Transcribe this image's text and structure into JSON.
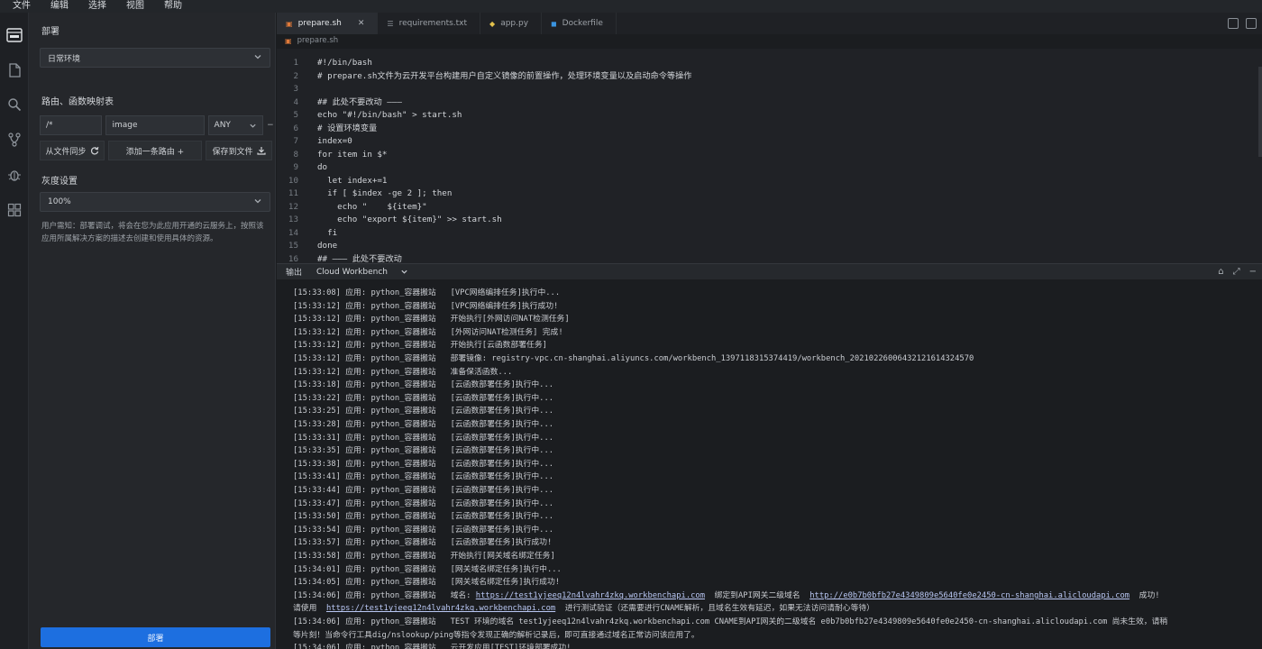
{
  "menu": [
    "文件",
    "编辑",
    "选择",
    "视图",
    "帮助"
  ],
  "sidebar": {
    "title": "部署",
    "env_select": "日常环境",
    "route_title": "路由、函数映射表",
    "route": {
      "path": "/*",
      "target": "image",
      "method": "ANY"
    },
    "sync_button": "从文件同步",
    "add_route_button": "添加一条路由 +",
    "save_file_button": "保存到文件",
    "gray_title": "灰度设置",
    "gray_value": "100%",
    "note": "用户需知：部署调试，将会在您为此应用开通的云服务上，按照该应用所属解决方案的描述去创建和使用具体的资源。",
    "deploy_button": "部署"
  },
  "tabs": [
    {
      "label": "prepare.sh",
      "active": true
    },
    {
      "label": "requirements.txt",
      "active": false
    },
    {
      "label": "app.py",
      "active": false
    },
    {
      "label": "Dockerfile",
      "active": false
    }
  ],
  "breadcrumb": "prepare.sh",
  "code": [
    {
      "n": "1",
      "t": "#!/bin/bash"
    },
    {
      "n": "2",
      "t": "# prepare.sh文件为云开发平台构建用户自定义镜像的前置操作，处理环境变量以及启动命令等操作"
    },
    {
      "n": "3",
      "t": ""
    },
    {
      "n": "4",
      "t": "## 此处不要改动 ———"
    },
    {
      "n": "5",
      "t": "echo \"#!/bin/bash\" > start.sh"
    },
    {
      "n": "6",
      "t": "# 设置环境变量"
    },
    {
      "n": "7",
      "t": "index=0"
    },
    {
      "n": "8",
      "t": "for item in $*"
    },
    {
      "n": "9",
      "t": "do"
    },
    {
      "n": "10",
      "t": "  let index+=1"
    },
    {
      "n": "11",
      "t": "  if [ $index -ge 2 ]; then"
    },
    {
      "n": "12",
      "t": "    echo \"    ${item}\""
    },
    {
      "n": "13",
      "t": "    echo \"export ${item}\" >> start.sh"
    },
    {
      "n": "14",
      "t": "  fi"
    },
    {
      "n": "15",
      "t": "done"
    },
    {
      "n": "16",
      "t": "## ——— 此处不要改动"
    }
  ],
  "panel": {
    "label": "输出",
    "channel": "Cloud Workbench"
  },
  "logs": [
    "[15:33:08] 应用: python_容器搬站   [VPC网络编排任务]执行中...",
    "[15:33:12] 应用: python_容器搬站   [VPC网络编排任务]执行成功!",
    "[15:33:12] 应用: python_容器搬站   开始执行[外网访问NAT检测任务]",
    "[15:33:12] 应用: python_容器搬站   [外网访问NAT检测任务] 完成!",
    "[15:33:12] 应用: python_容器搬站   开始执行[云函数部署任务]",
    "[15:33:12] 应用: python_容器搬站   部署镜像: registry-vpc.cn-shanghai.aliyuncs.com/workbench_1397118315374419/workbench_20210226006432121614324570",
    "[15:33:12] 应用: python_容器搬站   准备保活函数...",
    "[15:33:18] 应用: python_容器搬站   [云函数部署任务]执行中...",
    "[15:33:22] 应用: python_容器搬站   [云函数部署任务]执行中...",
    "[15:33:25] 应用: python_容器搬站   [云函数部署任务]执行中...",
    "[15:33:28] 应用: python_容器搬站   [云函数部署任务]执行中...",
    "[15:33:31] 应用: python_容器搬站   [云函数部署任务]执行中...",
    "[15:33:35] 应用: python_容器搬站   [云函数部署任务]执行中...",
    "[15:33:38] 应用: python_容器搬站   [云函数部署任务]执行中...",
    "[15:33:41] 应用: python_容器搬站   [云函数部署任务]执行中...",
    "[15:33:44] 应用: python_容器搬站   [云函数部署任务]执行中...",
    "[15:33:47] 应用: python_容器搬站   [云函数部署任务]执行中...",
    "[15:33:50] 应用: python_容器搬站   [云函数部署任务]执行中...",
    "[15:33:54] 应用: python_容器搬站   [云函数部署任务]执行中...",
    "[15:33:57] 应用: python_容器搬站   [云函数部署任务]执行成功!",
    "[15:33:58] 应用: python_容器搬站   开始执行[网关域名绑定任务]",
    "[15:34:01] 应用: python_容器搬站   [网关域名绑定任务]执行中...",
    "[15:34:05] 应用: python_容器搬站   [网关域名绑定任务]执行成功!"
  ],
  "log_domain_line": {
    "prefix": "[15:34:06] 应用: python_容器搬站   域名: ",
    "link1": "https://test1yjeeq12n4lvahr4zkq.workbenchapi.com",
    "mid": "  绑定到API网关二级域名  ",
    "link2": "http://e0b7b0bfb27e4349809e5640fe0e2450-cn-shanghai.alicloudapi.com",
    "suffix": "  成功!"
  },
  "log_please_line": {
    "prefix": "请使用  ",
    "link": "https://test1yjeeq12n4lvahr4zkq.workbenchapi.com",
    "suffix": "  进行测试验证（还需要进行CNAME解析，且域名生效有延迟，如果无法访问请耐心等待）"
  },
  "log_tail": [
    "[15:34:06] 应用: python_容器搬站   TEST 环境的域名 test1yjeeq12n4lvahr4zkq.workbenchapi.com CNAME到API网关的二级域名 e0b7b0bfb27e4349809e5640fe0e2450-cn-shanghai.alicloudapi.com 尚未生效，请稍",
    "等片刻！当命令行工具dig/nslookup/ping等指令发现正确的解析记录后，即可直接通过域名正常访问该应用了。",
    "[15:34:06] 应用: python_容器搬站   云开发应用[TEST]环境部署成功!"
  ]
}
